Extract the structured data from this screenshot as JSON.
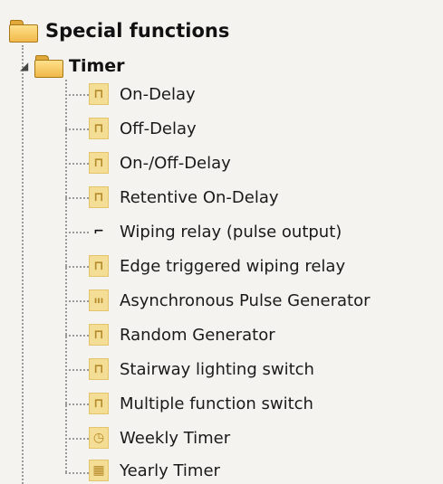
{
  "tree": {
    "root": {
      "label": "Special functions",
      "icon": "folder-icon"
    },
    "group": {
      "label": "Timer",
      "icon": "folder-open-icon",
      "expanded": true
    },
    "items": [
      {
        "label": "On-Delay",
        "icon": "on-delay-icon",
        "glyph": "⊓"
      },
      {
        "label": "Off-Delay",
        "icon": "off-delay-icon",
        "glyph": "⊓"
      },
      {
        "label": "On-/Off-Delay",
        "icon": "on-off-delay-icon",
        "glyph": "⊓"
      },
      {
        "label": "Retentive On-Delay",
        "icon": "retentive-on-delay-icon",
        "glyph": "⊓"
      },
      {
        "label": "Wiping relay (pulse output)",
        "icon": "wiping-relay-icon",
        "glyph": "⌐"
      },
      {
        "label": "Edge triggered wiping relay",
        "icon": "edge-wiping-relay-icon",
        "glyph": "⊓"
      },
      {
        "label": "Asynchronous Pulse Generator",
        "icon": "pulse-generator-icon",
        "glyph": "ııı"
      },
      {
        "label": "Random Generator",
        "icon": "random-generator-icon",
        "glyph": "⊓"
      },
      {
        "label": "Stairway lighting switch",
        "icon": "stairway-switch-icon",
        "glyph": "⊓"
      },
      {
        "label": "Multiple function switch",
        "icon": "multi-function-switch-icon",
        "glyph": "⊓"
      },
      {
        "label": "Weekly Timer",
        "icon": "clock-icon",
        "glyph": "◷"
      },
      {
        "label": "Yearly Timer",
        "icon": "calendar-icon",
        "glyph": "▦"
      }
    ]
  },
  "colors": {
    "background": "#f4f3ef",
    "icon_fill": "#f4dd94",
    "folder": "#f0b94a"
  }
}
